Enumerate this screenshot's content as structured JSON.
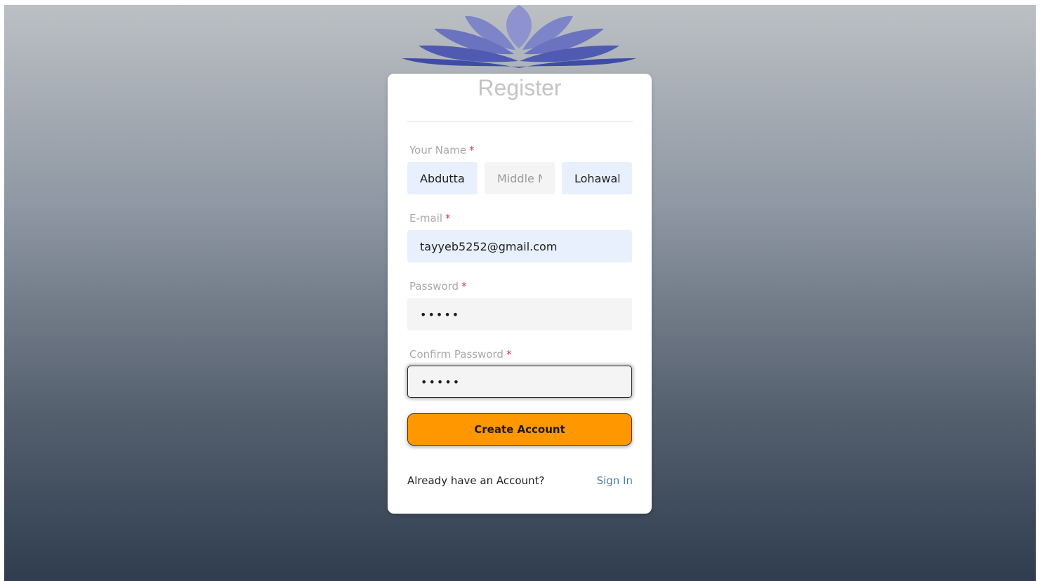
{
  "page": {
    "title": "Register"
  },
  "colors": {
    "accent": "#ff9800",
    "link": "#4f7fa3",
    "required": "#d23b3b",
    "autofill": "#e8f0fe",
    "logo": "#5a64b5"
  },
  "form": {
    "name_label": "Your Name",
    "required_mark": "*",
    "first_name_value": "Abduttayyeb",
    "middle_name_placeholder": "Middle Name",
    "last_name_value": "Lohawala",
    "email_label": "E-mail",
    "email_value": "tayyeb5252@gmail.com",
    "password_label": "Password",
    "password_value": "•••••",
    "confirm_label": "Confirm Password",
    "confirm_value": "•••••",
    "submit_label": "Create Account"
  },
  "footer": {
    "prompt": "Already have an Account?",
    "signin_label": "Sign In"
  },
  "icons": {
    "logo": "open-book-lotus-icon"
  }
}
